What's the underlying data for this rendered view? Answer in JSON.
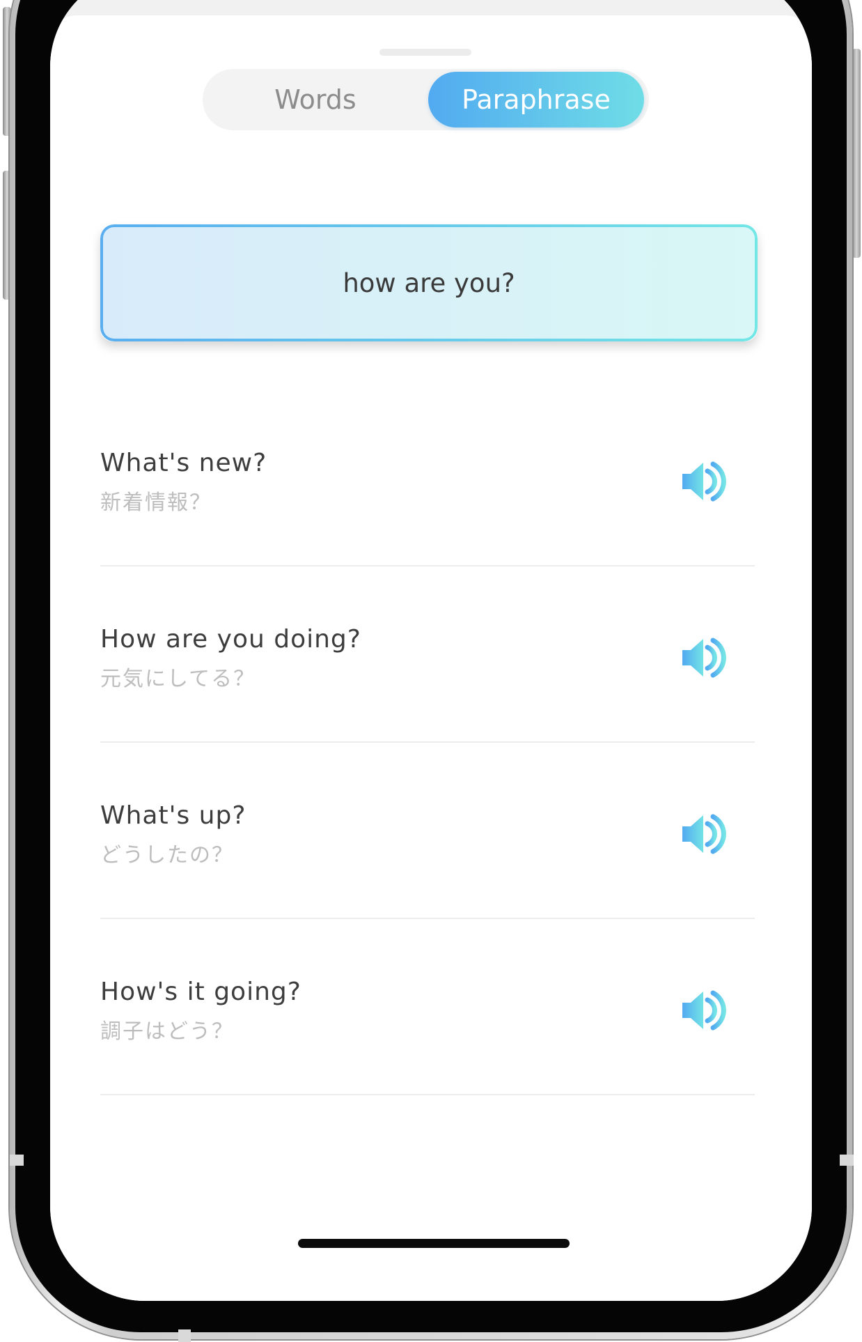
{
  "tabs": {
    "words": "Words",
    "paraphrase": "Paraphrase",
    "active": "paraphrase"
  },
  "query": "how are you?",
  "paraphrases": [
    {
      "english": "What's new?",
      "japanese": "新着情報？"
    },
    {
      "english": "How are you doing?",
      "japanese": "元気にしてる？"
    },
    {
      "english": "What's up?",
      "japanese": "どうしたの？"
    },
    {
      "english": "How's it going?",
      "japanese": "調子はどう？"
    }
  ],
  "icons": {
    "speaker": "speaker-icon"
  },
  "colors": {
    "accent_start": "#52aaf0",
    "accent_end": "#6fdde6",
    "primary_text": "#3d3d3d",
    "secondary_text": "#bdbdbd"
  }
}
